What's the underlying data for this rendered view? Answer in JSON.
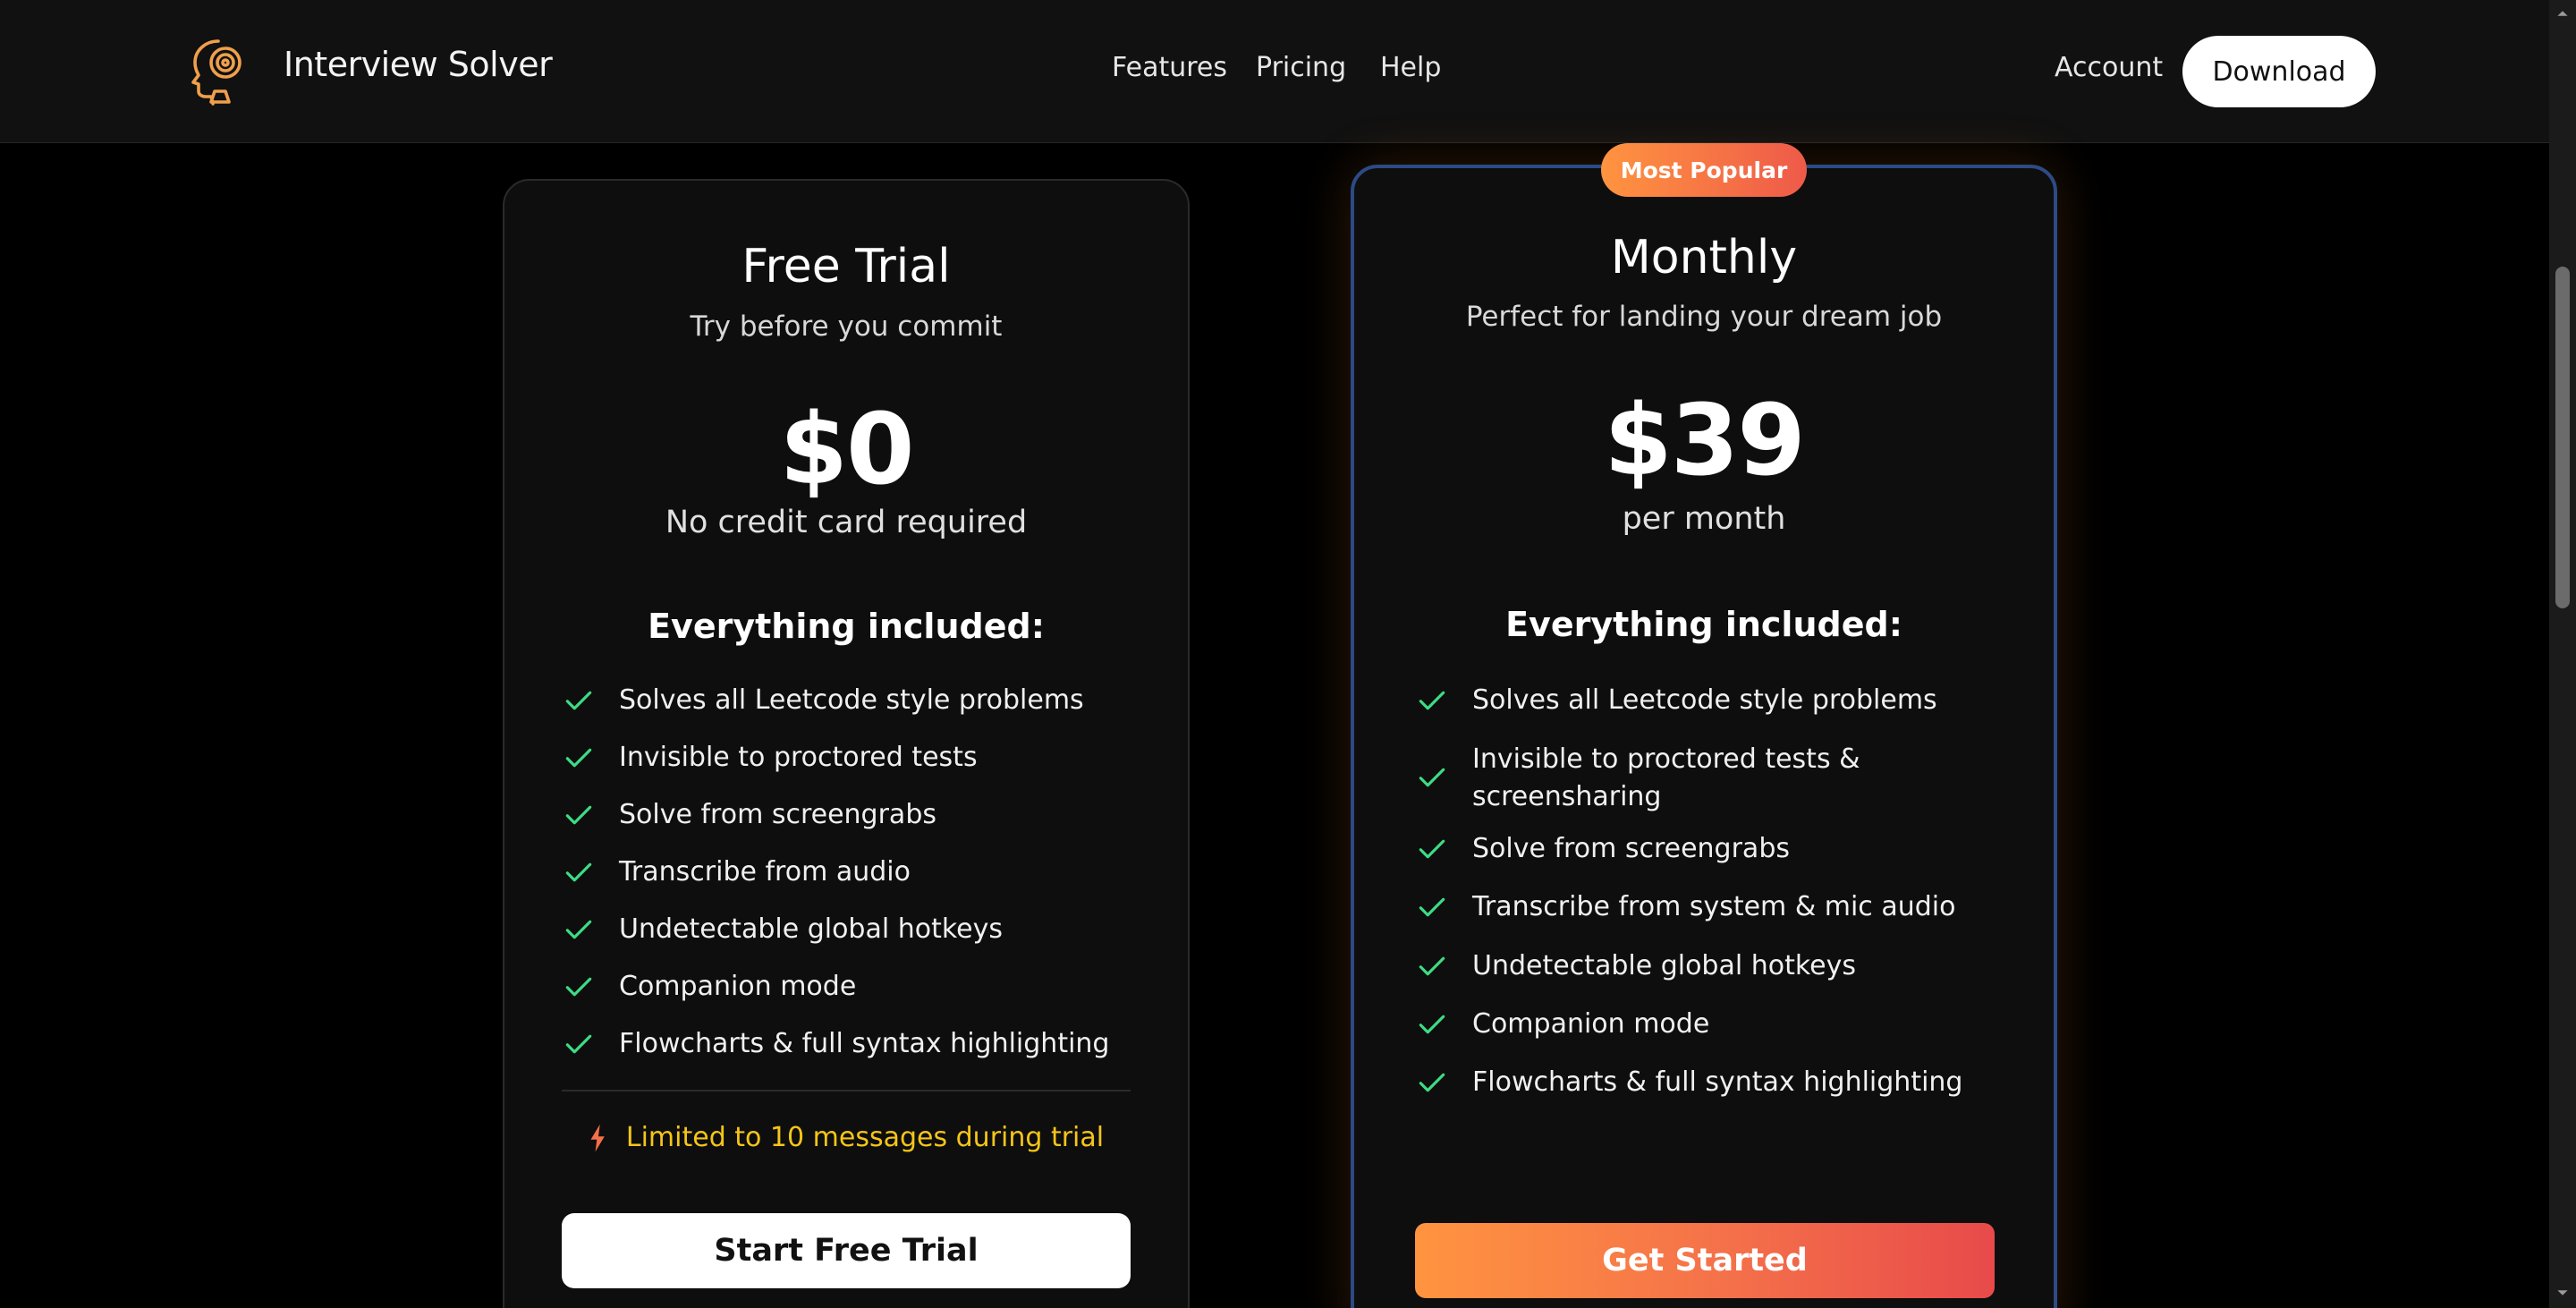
{
  "header": {
    "brand": "Interview Solver",
    "nav": [
      "Features",
      "Pricing",
      "Help"
    ],
    "account": "Account",
    "download": "Download"
  },
  "plans": {
    "free": {
      "title": "Free Trial",
      "subtitle": "Try before you commit",
      "price": "$0",
      "price_note": "No credit card required",
      "included_heading": "Everything included:",
      "features": [
        "Solves all Leetcode style problems",
        "Invisible to proctored tests",
        "Solve from screengrabs",
        "Transcribe from audio",
        "Undetectable global hotkeys",
        "Companion mode",
        "Flowcharts & full syntax highlighting"
      ],
      "limit_note": "Limited to 10 messages during trial",
      "cta": "Start Free Trial"
    },
    "monthly": {
      "badge": "Most Popular",
      "title": "Monthly",
      "subtitle": "Perfect for landing your dream job",
      "price": "$39",
      "price_note": "per month",
      "included_heading": "Everything included:",
      "features": [
        "Solves all Leetcode style problems",
        "Invisible to proctored tests & screensharing",
        "Solve from screengrabs",
        "Transcribe from system & mic audio",
        "Undetectable global hotkeys",
        "Companion mode",
        "Flowcharts & full syntax highlighting"
      ],
      "cta": "Get Started"
    }
  },
  "colors": {
    "accent_orange": "#ff9440",
    "accent_red": "#e84a4a",
    "check_green": "#3ddc84",
    "limit_yellow": "#f5c518",
    "popular_border": "#2c4a86"
  },
  "icons": {
    "logo": "head-with-gear-icon",
    "check": "check-icon",
    "bolt": "lightning-bolt-icon"
  }
}
